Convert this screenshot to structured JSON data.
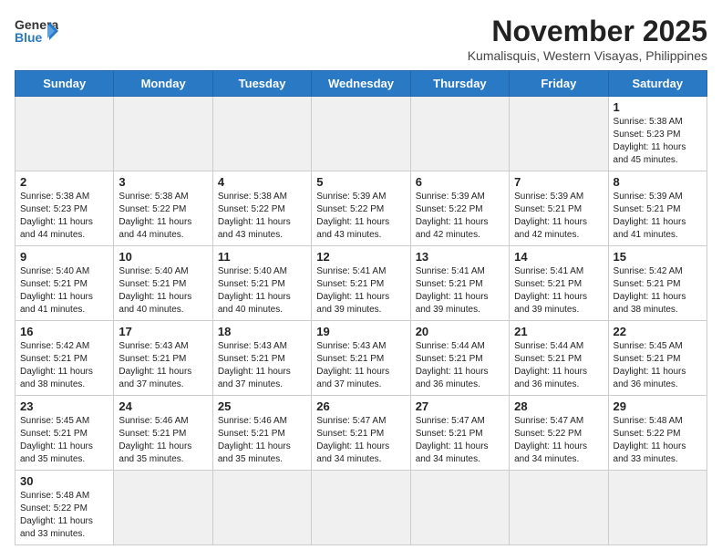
{
  "header": {
    "logo_line1": "General",
    "logo_line2": "Blue",
    "month": "November 2025",
    "location": "Kumalisquis, Western Visayas, Philippines"
  },
  "weekdays": [
    "Sunday",
    "Monday",
    "Tuesday",
    "Wednesday",
    "Thursday",
    "Friday",
    "Saturday"
  ],
  "weeks": [
    [
      {
        "day": "",
        "info": ""
      },
      {
        "day": "",
        "info": ""
      },
      {
        "day": "",
        "info": ""
      },
      {
        "day": "",
        "info": ""
      },
      {
        "day": "",
        "info": ""
      },
      {
        "day": "",
        "info": ""
      },
      {
        "day": "1",
        "info": "Sunrise: 5:38 AM\nSunset: 5:23 PM\nDaylight: 11 hours\nand 45 minutes."
      }
    ],
    [
      {
        "day": "2",
        "info": "Sunrise: 5:38 AM\nSunset: 5:23 PM\nDaylight: 11 hours\nand 44 minutes."
      },
      {
        "day": "3",
        "info": "Sunrise: 5:38 AM\nSunset: 5:22 PM\nDaylight: 11 hours\nand 44 minutes."
      },
      {
        "day": "4",
        "info": "Sunrise: 5:38 AM\nSunset: 5:22 PM\nDaylight: 11 hours\nand 43 minutes."
      },
      {
        "day": "5",
        "info": "Sunrise: 5:39 AM\nSunset: 5:22 PM\nDaylight: 11 hours\nand 43 minutes."
      },
      {
        "day": "6",
        "info": "Sunrise: 5:39 AM\nSunset: 5:22 PM\nDaylight: 11 hours\nand 42 minutes."
      },
      {
        "day": "7",
        "info": "Sunrise: 5:39 AM\nSunset: 5:21 PM\nDaylight: 11 hours\nand 42 minutes."
      },
      {
        "day": "8",
        "info": "Sunrise: 5:39 AM\nSunset: 5:21 PM\nDaylight: 11 hours\nand 41 minutes."
      }
    ],
    [
      {
        "day": "9",
        "info": "Sunrise: 5:40 AM\nSunset: 5:21 PM\nDaylight: 11 hours\nand 41 minutes."
      },
      {
        "day": "10",
        "info": "Sunrise: 5:40 AM\nSunset: 5:21 PM\nDaylight: 11 hours\nand 40 minutes."
      },
      {
        "day": "11",
        "info": "Sunrise: 5:40 AM\nSunset: 5:21 PM\nDaylight: 11 hours\nand 40 minutes."
      },
      {
        "day": "12",
        "info": "Sunrise: 5:41 AM\nSunset: 5:21 PM\nDaylight: 11 hours\nand 39 minutes."
      },
      {
        "day": "13",
        "info": "Sunrise: 5:41 AM\nSunset: 5:21 PM\nDaylight: 11 hours\nand 39 minutes."
      },
      {
        "day": "14",
        "info": "Sunrise: 5:41 AM\nSunset: 5:21 PM\nDaylight: 11 hours\nand 39 minutes."
      },
      {
        "day": "15",
        "info": "Sunrise: 5:42 AM\nSunset: 5:21 PM\nDaylight: 11 hours\nand 38 minutes."
      }
    ],
    [
      {
        "day": "16",
        "info": "Sunrise: 5:42 AM\nSunset: 5:21 PM\nDaylight: 11 hours\nand 38 minutes."
      },
      {
        "day": "17",
        "info": "Sunrise: 5:43 AM\nSunset: 5:21 PM\nDaylight: 11 hours\nand 37 minutes."
      },
      {
        "day": "18",
        "info": "Sunrise: 5:43 AM\nSunset: 5:21 PM\nDaylight: 11 hours\nand 37 minutes."
      },
      {
        "day": "19",
        "info": "Sunrise: 5:43 AM\nSunset: 5:21 PM\nDaylight: 11 hours\nand 37 minutes."
      },
      {
        "day": "20",
        "info": "Sunrise: 5:44 AM\nSunset: 5:21 PM\nDaylight: 11 hours\nand 36 minutes."
      },
      {
        "day": "21",
        "info": "Sunrise: 5:44 AM\nSunset: 5:21 PM\nDaylight: 11 hours\nand 36 minutes."
      },
      {
        "day": "22",
        "info": "Sunrise: 5:45 AM\nSunset: 5:21 PM\nDaylight: 11 hours\nand 36 minutes."
      }
    ],
    [
      {
        "day": "23",
        "info": "Sunrise: 5:45 AM\nSunset: 5:21 PM\nDaylight: 11 hours\nand 35 minutes."
      },
      {
        "day": "24",
        "info": "Sunrise: 5:46 AM\nSunset: 5:21 PM\nDaylight: 11 hours\nand 35 minutes."
      },
      {
        "day": "25",
        "info": "Sunrise: 5:46 AM\nSunset: 5:21 PM\nDaylight: 11 hours\nand 35 minutes."
      },
      {
        "day": "26",
        "info": "Sunrise: 5:47 AM\nSunset: 5:21 PM\nDaylight: 11 hours\nand 34 minutes."
      },
      {
        "day": "27",
        "info": "Sunrise: 5:47 AM\nSunset: 5:21 PM\nDaylight: 11 hours\nand 34 minutes."
      },
      {
        "day": "28",
        "info": "Sunrise: 5:47 AM\nSunset: 5:22 PM\nDaylight: 11 hours\nand 34 minutes."
      },
      {
        "day": "29",
        "info": "Sunrise: 5:48 AM\nSunset: 5:22 PM\nDaylight: 11 hours\nand 33 minutes."
      }
    ],
    [
      {
        "day": "30",
        "info": "Sunrise: 5:48 AM\nSunset: 5:22 PM\nDaylight: 11 hours\nand 33 minutes."
      },
      {
        "day": "",
        "info": ""
      },
      {
        "day": "",
        "info": ""
      },
      {
        "day": "",
        "info": ""
      },
      {
        "day": "",
        "info": ""
      },
      {
        "day": "",
        "info": ""
      },
      {
        "day": "",
        "info": ""
      }
    ]
  ]
}
